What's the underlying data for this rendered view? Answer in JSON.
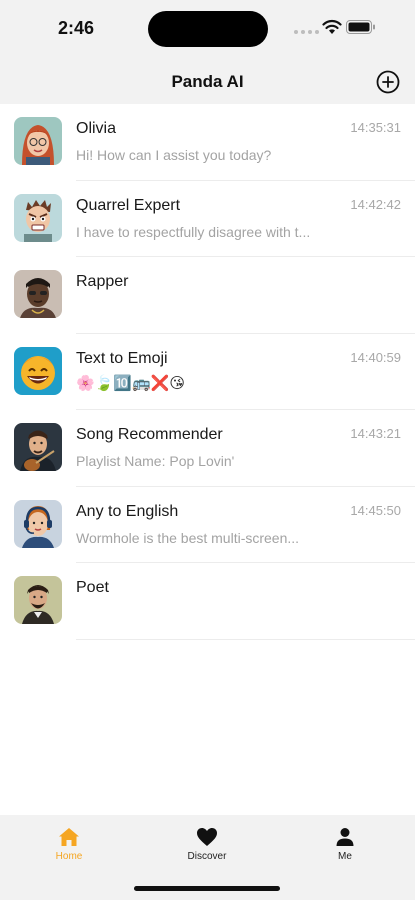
{
  "status_bar": {
    "time": "2:46"
  },
  "header": {
    "title": "Panda AI",
    "add_icon": "plus-circle-icon"
  },
  "chats": [
    {
      "name": "Olivia",
      "time": "14:35:31",
      "preview": "Hi! How can I assist you today?",
      "avatar": "woman-red-hair-avatar"
    },
    {
      "name": "Quarrel Expert",
      "time": "14:42:42",
      "preview": "I have to respectfully disagree with t...",
      "avatar": "angry-man-avatar"
    },
    {
      "name": "Rapper",
      "time": "",
      "preview": "",
      "avatar": "rapper-avatar"
    },
    {
      "name": "Text to Emoji",
      "time": "14:40:59",
      "preview": "🌸🍃🔟🚌❌😘",
      "avatar": "grinning-emoji-avatar"
    },
    {
      "name": "Song Recommender",
      "time": "14:43:21",
      "preview": "Playlist Name: Pop Lovin'",
      "avatar": "guitarist-avatar"
    },
    {
      "name": "Any to English",
      "time": "14:45:50",
      "preview": "Wormhole is the best multi-screen...",
      "avatar": "headset-woman-avatar"
    },
    {
      "name": "Poet",
      "time": "",
      "preview": "",
      "avatar": "poet-avatar"
    }
  ],
  "tabs": [
    {
      "label": "Home",
      "icon": "home-icon",
      "active": true
    },
    {
      "label": "Discover",
      "icon": "heart-icon",
      "active": false
    },
    {
      "label": "Me",
      "icon": "person-icon",
      "active": false
    }
  ],
  "colors": {
    "accent": "#f5a623",
    "background": "#f2f2f2",
    "muted_text": "#a3a3a3"
  }
}
